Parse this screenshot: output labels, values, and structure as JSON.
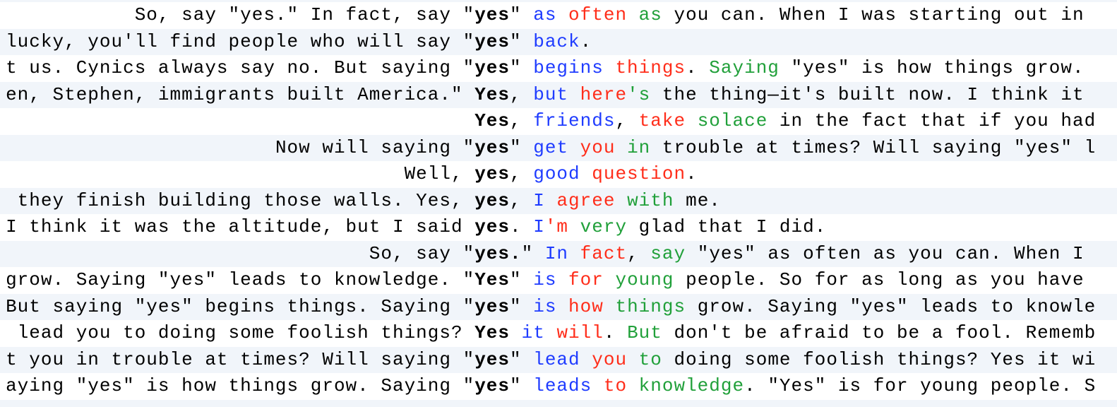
{
  "colors": {
    "blue": "#1f3cff",
    "red": "#ff2d1a",
    "green": "#21a03a",
    "plain": "#000000",
    "row_alt_bg": "#f1f5fa"
  },
  "rows": [
    {
      "left": "So, say \"yes.\" In fact, say \"",
      "kw": "yes",
      "right": [
        [
          "\" ",
          "plain"
        ],
        [
          "as",
          "blue"
        ],
        [
          " ",
          "plain"
        ],
        [
          "often",
          "red"
        ],
        [
          " ",
          "plain"
        ],
        [
          "as",
          "green"
        ],
        [
          " you can. When I was starting out in",
          "plain"
        ]
      ]
    },
    {
      "left": "lucky, you'll find people who will say \"",
      "kw": "yes",
      "right": [
        [
          "\" ",
          "plain"
        ],
        [
          "back",
          "blue"
        ],
        [
          ".",
          "plain"
        ]
      ]
    },
    {
      "left": "t us. Cynics always say no. But saying \"",
      "kw": "yes",
      "right": [
        [
          "\" ",
          "plain"
        ],
        [
          "begins",
          "blue"
        ],
        [
          " ",
          "plain"
        ],
        [
          "things",
          "red"
        ],
        [
          ". ",
          "plain"
        ],
        [
          "Saying",
          "green"
        ],
        [
          " \"yes\" is how things grow.",
          "plain"
        ]
      ]
    },
    {
      "left": "en, Stephen, immigrants built America.\" ",
      "kw": "Yes",
      "right": [
        [
          ", ",
          "plain"
        ],
        [
          "but",
          "blue"
        ],
        [
          " ",
          "plain"
        ],
        [
          "here",
          "red"
        ],
        [
          "'s",
          "green"
        ],
        [
          " the thing—it's built now. I think it",
          "plain"
        ]
      ]
    },
    {
      "left": "",
      "kw": "Yes",
      "right": [
        [
          ", ",
          "plain"
        ],
        [
          "friends",
          "blue"
        ],
        [
          ", ",
          "plain"
        ],
        [
          "take",
          "red"
        ],
        [
          " ",
          "plain"
        ],
        [
          "solace",
          "green"
        ],
        [
          " in the fact that if you had",
          "plain"
        ]
      ]
    },
    {
      "left": "Now will saying \"",
      "kw": "yes",
      "right": [
        [
          "\" ",
          "plain"
        ],
        [
          "get",
          "blue"
        ],
        [
          " ",
          "plain"
        ],
        [
          "you",
          "red"
        ],
        [
          " ",
          "plain"
        ],
        [
          "in",
          "green"
        ],
        [
          " trouble at times? Will saying \"yes\" l",
          "plain"
        ]
      ]
    },
    {
      "left": "Well, ",
      "kw": "yes",
      "right": [
        [
          ", ",
          "plain"
        ],
        [
          "good",
          "blue"
        ],
        [
          " ",
          "plain"
        ],
        [
          "question",
          "red"
        ],
        [
          ".",
          "plain"
        ]
      ]
    },
    {
      "left": " they finish building those walls. Yes, ",
      "kw": "yes",
      "right": [
        [
          ", ",
          "plain"
        ],
        [
          "I",
          "blue"
        ],
        [
          " ",
          "plain"
        ],
        [
          "agree",
          "red"
        ],
        [
          " ",
          "plain"
        ],
        [
          "with",
          "green"
        ],
        [
          " me.",
          "plain"
        ]
      ]
    },
    {
      "left": "I think it was the altitude, but I said ",
      "kw": "yes",
      "right": [
        [
          ". ",
          "plain"
        ],
        [
          "I",
          "blue"
        ],
        [
          "'m",
          "red"
        ],
        [
          " ",
          "plain"
        ],
        [
          "very",
          "green"
        ],
        [
          " glad that I did.",
          "plain"
        ]
      ]
    },
    {
      "left": "So, say \"",
      "kw": "yes",
      "kw2": ".",
      "right": [
        [
          "\" ",
          "plain"
        ],
        [
          "In",
          "blue"
        ],
        [
          " ",
          "plain"
        ],
        [
          "fact",
          "red"
        ],
        [
          ", ",
          "plain"
        ],
        [
          "say",
          "green"
        ],
        [
          " \"yes\" as often as you can. When I",
          "plain"
        ]
      ]
    },
    {
      "left": "grow. Saying \"yes\" leads to knowledge. \"",
      "kw": "Yes",
      "right": [
        [
          "\" ",
          "plain"
        ],
        [
          "is",
          "blue"
        ],
        [
          " ",
          "plain"
        ],
        [
          "for",
          "red"
        ],
        [
          " ",
          "plain"
        ],
        [
          "young",
          "green"
        ],
        [
          " people. So for as long as you have",
          "plain"
        ]
      ]
    },
    {
      "left": "But saying \"yes\" begins things. Saying \"",
      "kw": "yes",
      "right": [
        [
          "\" ",
          "plain"
        ],
        [
          "is",
          "blue"
        ],
        [
          " ",
          "plain"
        ],
        [
          "how",
          "red"
        ],
        [
          " ",
          "plain"
        ],
        [
          "things",
          "green"
        ],
        [
          " grow. Saying \"yes\" leads to knowle",
          "plain"
        ]
      ]
    },
    {
      "left": " lead you to doing some foolish things? ",
      "kw": "Yes",
      "right": [
        [
          " ",
          "plain"
        ],
        [
          "it",
          "blue"
        ],
        [
          " ",
          "plain"
        ],
        [
          "will",
          "red"
        ],
        [
          ". ",
          "plain"
        ],
        [
          "But",
          "green"
        ],
        [
          " don't be afraid to be a fool. Rememb",
          "plain"
        ]
      ]
    },
    {
      "left": "t you in trouble at times? Will saying \"",
      "kw": "yes",
      "right": [
        [
          "\" ",
          "plain"
        ],
        [
          "lead",
          "blue"
        ],
        [
          " ",
          "plain"
        ],
        [
          "you",
          "red"
        ],
        [
          " ",
          "plain"
        ],
        [
          "to",
          "green"
        ],
        [
          " doing some foolish things? Yes it wi",
          "plain"
        ]
      ]
    },
    {
      "left": "aying \"yes\" is how things grow. Saying \"",
      "kw": "yes",
      "right": [
        [
          "\" ",
          "plain"
        ],
        [
          "leads",
          "blue"
        ],
        [
          " ",
          "plain"
        ],
        [
          "to",
          "red"
        ],
        [
          " ",
          "plain"
        ],
        [
          "knowledge",
          "green"
        ],
        [
          ". \"Yes\" is for young people. S",
          "plain"
        ]
      ]
    }
  ]
}
